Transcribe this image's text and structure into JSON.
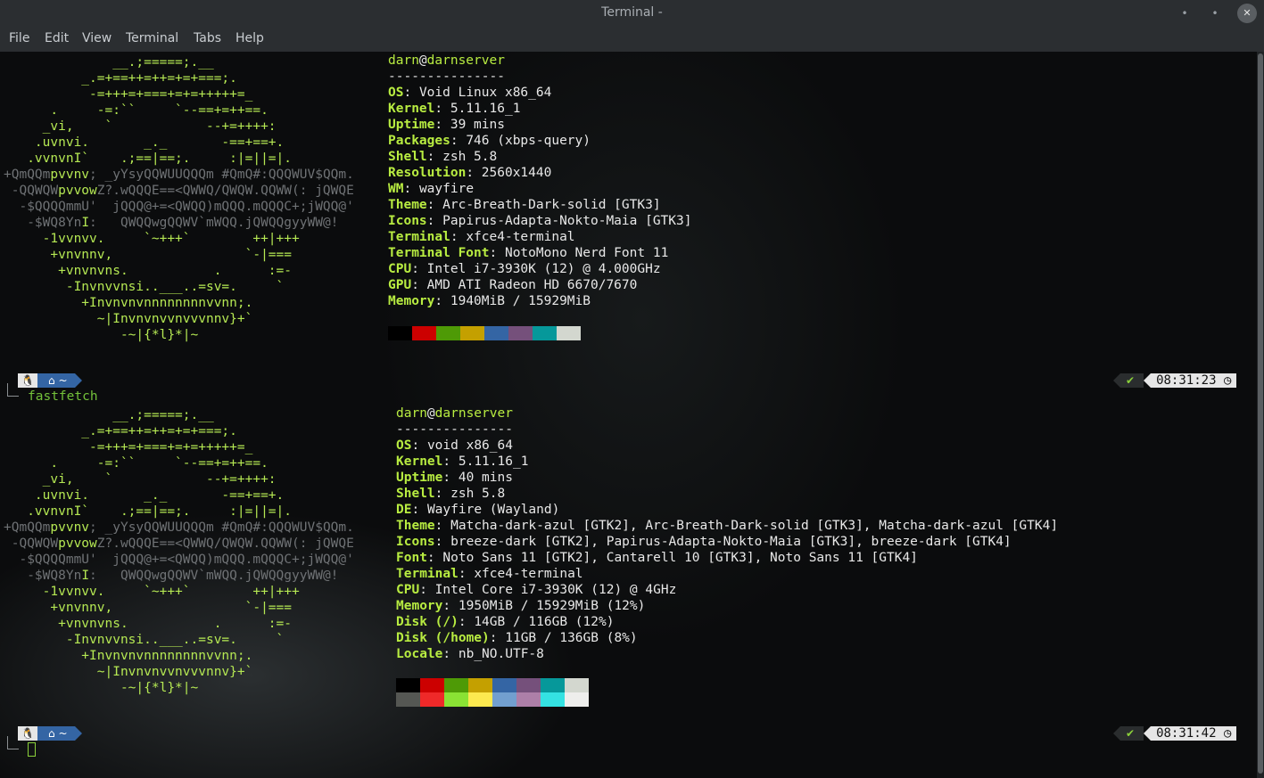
{
  "window": {
    "title": "Terminal -",
    "minimize_icon": "•",
    "maximize_icon": "•",
    "close_icon": "✕"
  },
  "menu": [
    "File",
    "Edit",
    "View",
    "Terminal",
    "Tabs",
    "Help"
  ],
  "blocks": [
    {
      "user": "darn",
      "host": "darnserver",
      "separator": "---------------",
      "info": [
        [
          "OS",
          "Void Linux x86_64"
        ],
        [
          "Kernel",
          "5.11.16_1"
        ],
        [
          "Uptime",
          "39 mins"
        ],
        [
          "Packages",
          "746 (xbps-query)"
        ],
        [
          "Shell",
          "zsh 5.8"
        ],
        [
          "Resolution",
          "2560x1440"
        ],
        [
          "WM",
          "wayfire"
        ],
        [
          "Theme",
          "Arc-Breath-Dark-solid [GTK3]"
        ],
        [
          "Icons",
          "Papirus-Adapta-Nokto-Maia [GTK3]"
        ],
        [
          "Terminal",
          "xfce4-terminal"
        ],
        [
          "Terminal Font",
          "NotoMono Nerd Font 11"
        ],
        [
          "CPU",
          "Intel i7-3930K (12) @ 4.000GHz"
        ],
        [
          "GPU",
          "AMD ATI Radeon HD 6670/7670"
        ],
        [
          "Memory",
          "1940MiB / 15929MiB"
        ]
      ],
      "palette_rows": [
        [
          "#000000",
          "#cc0000",
          "#4e9a06",
          "#c4a000",
          "#3465a4",
          "#75507b",
          "#06989a",
          "#d3d7cf"
        ]
      ]
    },
    {
      "user": "darn",
      "host": "darnserver",
      "separator": "---------------",
      "info": [
        [
          "OS",
          "void x86_64"
        ],
        [
          "Kernel",
          "5.11.16_1"
        ],
        [
          "Uptime",
          "40 mins"
        ],
        [
          "Shell",
          "zsh 5.8"
        ],
        [
          "DE",
          "Wayfire (Wayland)"
        ],
        [
          "Theme",
          "Matcha-dark-azul [GTK2], Arc-Breath-Dark-solid [GTK3], Matcha-dark-azul [GTK4]"
        ],
        [
          "Icons",
          "breeze-dark [GTK2], Papirus-Adapta-Nokto-Maia [GTK3], breeze-dark [GTK4]"
        ],
        [
          "Font",
          "Noto Sans 11 [GTK2], Cantarell 10 [GTK3], Noto Sans 11 [GTK4]"
        ],
        [
          "Terminal",
          "xfce4-terminal"
        ],
        [
          "CPU",
          "Intel Core i7-3930K (12) @ 4GHz"
        ],
        [
          "Memory",
          "1950MiB / 15929MiB (12%)"
        ],
        [
          "Disk (/)",
          "14GB / 116GB (12%)"
        ],
        [
          "Disk (/home)",
          "11GB / 136GB (8%)"
        ],
        [
          "Locale",
          "nb_NO.UTF-8"
        ]
      ],
      "palette_rows": [
        [
          "#000000",
          "#cc0000",
          "#4e9a06",
          "#c4a000",
          "#3465a4",
          "#75507b",
          "#06989a",
          "#d3d7cf"
        ],
        [
          "#555753",
          "#ef2929",
          "#8ae234",
          "#fce94f",
          "#729fcf",
          "#ad7fa8",
          "#34e2e2",
          "#eeeeec"
        ]
      ]
    }
  ],
  "ascii_art": [
    [
      "              __.;=====;.__",
      ""
    ],
    [
      "          _.=+==++=++=+=+===;.",
      ""
    ],
    [
      "           -=+++=+===+=+=+++++=_",
      ""
    ],
    [
      "      .     -=:``     `--==+=++==.",
      ""
    ],
    [
      "     _vi,    `            --+=++++:",
      ""
    ],
    [
      "    .uvnvi.       _._       -==+==+.",
      ""
    ],
    [
      "   .vvnvnI`    .;==|==;.     :|=||=|.",
      ""
    ],
    [
      "+QmQQmpvvnv; _yYsyQQWUUQQQm #QmQ#:QQQWUV$QQm.",
      "mix1"
    ],
    [
      " -QQWQWpvvowZ?.wQQQE==<QWWQ/QWQW.QQWW(: jQWQE",
      "mix2"
    ],
    [
      "  -$QQQQmmU'  jQQQ@+=<QWQQ)mQQQ.mQQQC+;jWQQ@'",
      "mix3"
    ],
    [
      "   -$WQ8YnI:   QWQQwgQQWV`mWQQ.jQWQQgyyWW@!",
      "mix4"
    ],
    [
      "     -1vvnvv.     `~+++`        ++|+++",
      ""
    ],
    [
      "      +vnvnnv,                 `-|===",
      ""
    ],
    [
      "       +vnvnvns.           .      :=-",
      ""
    ],
    [
      "        -Invnvvnsi..___..=sv=.     `",
      ""
    ],
    [
      "          +Invnvnvnnnnnnnnvvnn;.",
      ""
    ],
    [
      "            ~|Invnvnvvnvvvnnv}+`",
      ""
    ],
    [
      "               -~|{*l}*|~",
      ""
    ]
  ],
  "prompts": [
    {
      "os_icon": "🐧",
      "dir_icon": "⌂",
      "dir": "~",
      "status_icon": "✔",
      "time": "08:31:23",
      "clock_icon": "◷",
      "command": "fastfetch"
    },
    {
      "os_icon": "🐧",
      "dir_icon": "⌂",
      "dir": "~",
      "status_icon": "✔",
      "time": "08:31:42",
      "clock_icon": "◷",
      "command": ""
    }
  ]
}
